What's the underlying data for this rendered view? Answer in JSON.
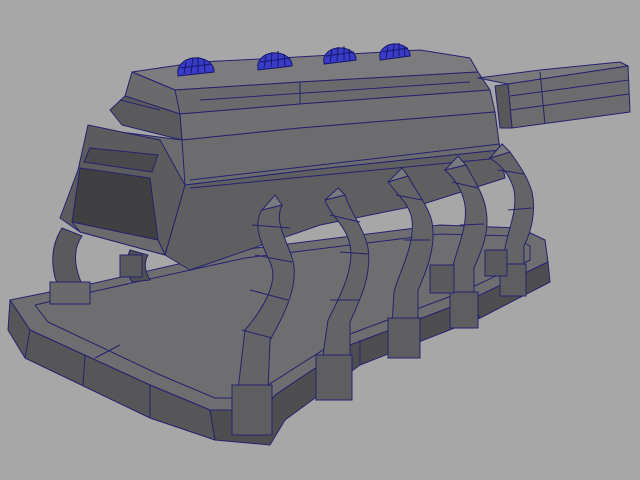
{
  "viewport": {
    "background": "#a7a7a7",
    "wire_color": "#24226e"
  },
  "model": {
    "parts": [
      "base-platform",
      "main-housing",
      "side-barrel",
      "dome-lights",
      "curved-legs"
    ],
    "colors": {
      "face_light": "#7a7a7c",
      "face_mid": "#6b6b6d",
      "face_dark": "#555557",
      "face_deep": "#434345",
      "dome": "#3a3cc8",
      "dome_wire": "#15166a"
    },
    "dome_count": 4,
    "leg_count": 5
  }
}
